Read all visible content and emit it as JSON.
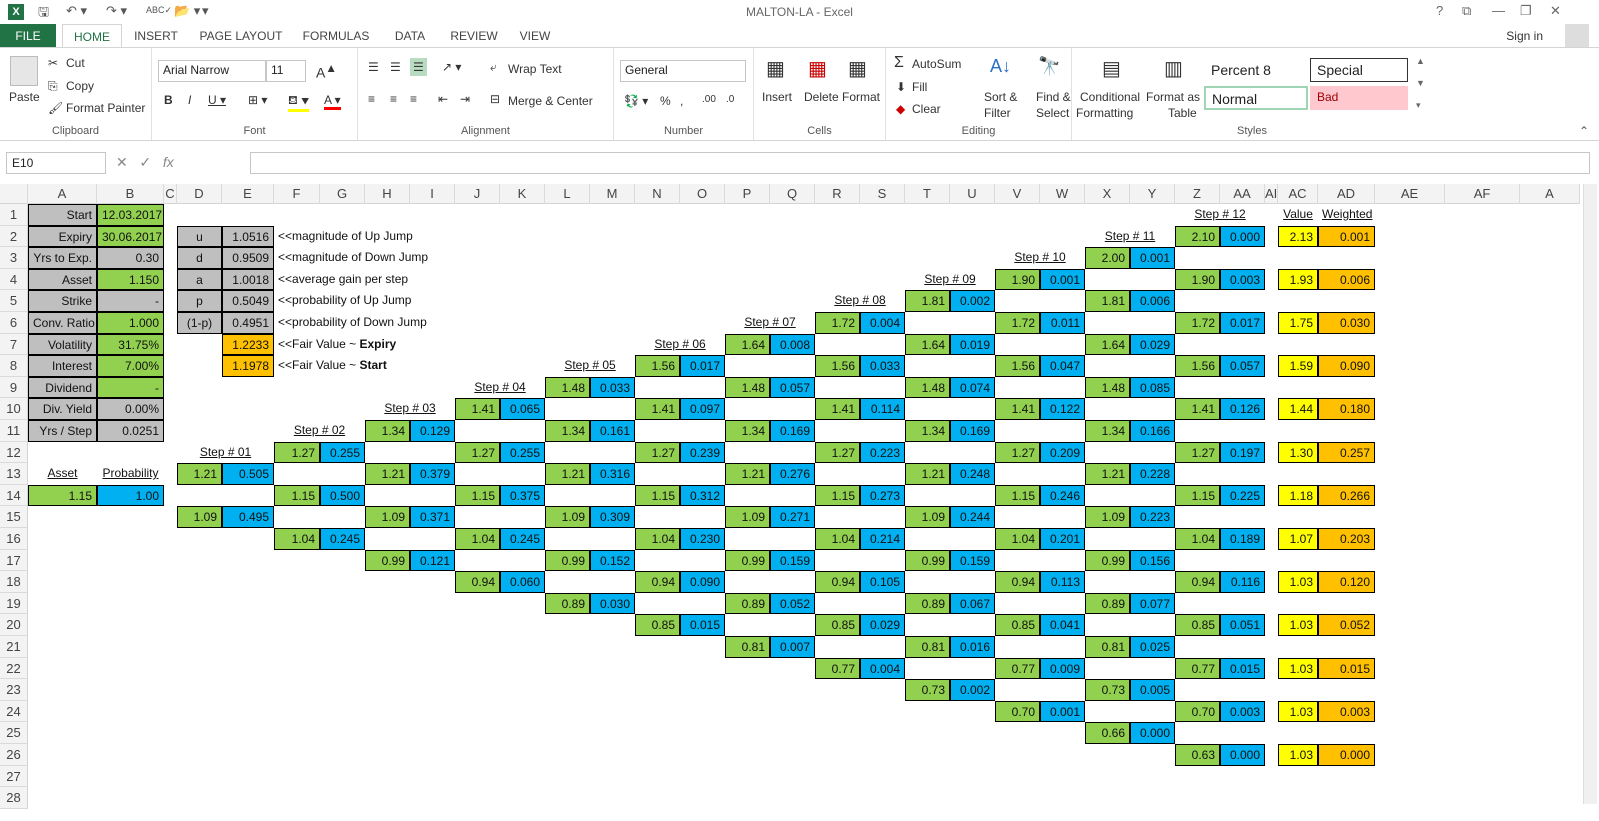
{
  "window": {
    "title": "MALTON-LA - Excel",
    "help": "?",
    "restore": "❐",
    "minimize": "—",
    "close": "✕"
  },
  "qat": {
    "save": "💾",
    "undo": "↶",
    "redo": "↷"
  },
  "ribbon_tabs": [
    "FILE",
    "HOME",
    "INSERT",
    "PAGE LAYOUT",
    "FORMULAS",
    "DATA",
    "REVIEW",
    "VIEW"
  ],
  "signin": "Sign in",
  "clipboard": {
    "paste": "Paste",
    "cut": "Cut",
    "copy": "Copy",
    "format_painter": "Format Painter",
    "label": "Clipboard"
  },
  "font": {
    "name": "Arial Narrow",
    "size": "11",
    "label": "Font"
  },
  "alignment": {
    "wrap": "Wrap Text",
    "merge": "Merge & Center",
    "label": "Alignment"
  },
  "number": {
    "format": "General",
    "label": "Number"
  },
  "cells": {
    "insert": "Insert",
    "delete": "Delete",
    "format": "Format",
    "label": "Cells"
  },
  "editing": {
    "autosum": "AutoSum",
    "fill": "Fill",
    "clear": "Clear",
    "sort": "Sort &",
    "sort2": "Filter",
    "find": "Find &",
    "find2": "Select",
    "label": "Editing"
  },
  "styles": {
    "cond": "Conditional",
    "cond2": "Formatting",
    "fmt_table": "Format as",
    "fmt_table2": "Table",
    "percent8": "Percent 8",
    "special": "Special",
    "normal": "Normal",
    "bad": "Bad",
    "label": "Styles"
  },
  "formula_bar": {
    "name_box": "E10",
    "formula": ""
  },
  "columns": [
    "A",
    "B",
    "C",
    "D",
    "E",
    "F",
    "G",
    "H",
    "I",
    "J",
    "K",
    "L",
    "M",
    "N",
    "O",
    "P",
    "Q",
    "R",
    "S",
    "T",
    "U",
    "V",
    "W",
    "X",
    "Y",
    "Z",
    "AA",
    "AI",
    "AC",
    "AD",
    "AE",
    "AF",
    "A"
  ],
  "rows": [
    "1",
    "2",
    "3",
    "4",
    "5",
    "6",
    "7",
    "8",
    "9",
    "10",
    "11",
    "12",
    "13",
    "14",
    "15",
    "16",
    "17",
    "18",
    "19",
    "20",
    "21",
    "22",
    "23",
    "24",
    "25",
    "26",
    "27",
    "28"
  ],
  "params": [
    {
      "label": "Start",
      "value": "12.03.2017"
    },
    {
      "label": "Expiry",
      "value": "30.06.2017"
    },
    {
      "label": "Yrs to Exp.",
      "value": "0.30"
    },
    {
      "label": "Asset",
      "value": "1.150"
    },
    {
      "label": "Strike",
      "value": "-"
    },
    {
      "label": "Conv. Ratio",
      "value": "1.000"
    },
    {
      "label": "Volatility",
      "value": "31.75%"
    },
    {
      "label": "Interest",
      "value": "7.00%"
    },
    {
      "label": "Dividend",
      "value": "-"
    },
    {
      "label": "Div. Yield",
      "value": "0.00%"
    },
    {
      "label": "Yrs / Step",
      "value": "0.0251"
    }
  ],
  "jumps": [
    {
      "k": "u",
      "v": "1.0516",
      "note": "<<magnitude of Up Jump"
    },
    {
      "k": "d",
      "v": "0.9509",
      "note": "<<magnitude of Down Jump"
    },
    {
      "k": "a",
      "v": "1.0018",
      "note": "<<average gain per step"
    },
    {
      "k": "p",
      "v": "0.5049",
      "note": "<<probability of Up Jump"
    },
    {
      "k": "(1-p)",
      "v": "0.4951",
      "note": "<<probability of Down Jump"
    }
  ],
  "fair": [
    {
      "v": "1.2233",
      "pre": "<<Fair Value ~ ",
      "bold": "Expiry"
    },
    {
      "v": "1.1978",
      "pre": "<<Fair Value ~ ",
      "bold": "Start"
    }
  ],
  "start_block": {
    "h_asset": "Asset",
    "h_prob": "Probability",
    "asset": "1.15",
    "prob": "1.00"
  },
  "steps": [
    {
      "label": "Step # 01",
      "nodes": [
        [
          "1.21",
          "0.505"
        ],
        [
          "1.09",
          "0.495"
        ]
      ]
    },
    {
      "label": "Step # 02",
      "nodes": [
        [
          "1.27",
          "0.255"
        ],
        [
          "1.15",
          "0.500"
        ],
        [
          "1.04",
          "0.245"
        ]
      ]
    },
    {
      "label": "Step # 03",
      "nodes": [
        [
          "1.34",
          "0.129"
        ],
        [
          "1.21",
          "0.379"
        ],
        [
          "1.09",
          "0.371"
        ],
        [
          "0.99",
          "0.121"
        ]
      ]
    },
    {
      "label": "Step # 04",
      "nodes": [
        [
          "1.41",
          "0.065"
        ],
        [
          "1.27",
          "0.255"
        ],
        [
          "1.15",
          "0.375"
        ],
        [
          "1.04",
          "0.245"
        ],
        [
          "0.94",
          "0.060"
        ]
      ]
    },
    {
      "label": "Step # 05",
      "nodes": [
        [
          "1.48",
          "0.033"
        ],
        [
          "1.34",
          "0.161"
        ],
        [
          "1.21",
          "0.316"
        ],
        [
          "1.09",
          "0.309"
        ],
        [
          "0.99",
          "0.152"
        ],
        [
          "0.89",
          "0.030"
        ]
      ]
    },
    {
      "label": "Step # 06",
      "nodes": [
        [
          "1.56",
          "0.017"
        ],
        [
          "1.41",
          "0.097"
        ],
        [
          "1.27",
          "0.239"
        ],
        [
          "1.15",
          "0.312"
        ],
        [
          "1.04",
          "0.230"
        ],
        [
          "0.94",
          "0.090"
        ],
        [
          "0.85",
          "0.015"
        ]
      ]
    },
    {
      "label": "Step # 07",
      "nodes": [
        [
          "1.64",
          "0.008"
        ],
        [
          "1.48",
          "0.057"
        ],
        [
          "1.34",
          "0.169"
        ],
        [
          "1.21",
          "0.276"
        ],
        [
          "1.09",
          "0.271"
        ],
        [
          "0.99",
          "0.159"
        ],
        [
          "0.89",
          "0.052"
        ],
        [
          "0.81",
          "0.007"
        ]
      ]
    },
    {
      "label": "Step # 08",
      "nodes": [
        [
          "1.72",
          "0.004"
        ],
        [
          "1.56",
          "0.033"
        ],
        [
          "1.41",
          "0.114"
        ],
        [
          "1.27",
          "0.223"
        ],
        [
          "1.15",
          "0.273"
        ],
        [
          "1.04",
          "0.214"
        ],
        [
          "0.94",
          "0.105"
        ],
        [
          "0.85",
          "0.029"
        ],
        [
          "0.77",
          "0.004"
        ]
      ]
    },
    {
      "label": "Step # 09",
      "nodes": [
        [
          "1.81",
          "0.002"
        ],
        [
          "1.64",
          "0.019"
        ],
        [
          "1.48",
          "0.074"
        ],
        [
          "1.34",
          "0.169"
        ],
        [
          "1.21",
          "0.248"
        ],
        [
          "1.09",
          "0.244"
        ],
        [
          "0.99",
          "0.159"
        ],
        [
          "0.89",
          "0.067"
        ],
        [
          "0.81",
          "0.016"
        ],
        [
          "0.73",
          "0.002"
        ]
      ]
    },
    {
      "label": "Step # 10",
      "nodes": [
        [
          "1.90",
          "0.001"
        ],
        [
          "1.72",
          "0.011"
        ],
        [
          "1.56",
          "0.047"
        ],
        [
          "1.41",
          "0.122"
        ],
        [
          "1.27",
          "0.209"
        ],
        [
          "1.15",
          "0.246"
        ],
        [
          "1.04",
          "0.201"
        ],
        [
          "0.94",
          "0.113"
        ],
        [
          "0.85",
          "0.041"
        ],
        [
          "0.77",
          "0.009"
        ],
        [
          "0.70",
          "0.001"
        ]
      ]
    },
    {
      "label": "Step # 11",
      "nodes": [
        [
          "2.00",
          "0.001"
        ],
        [
          "1.81",
          "0.006"
        ],
        [
          "1.64",
          "0.029"
        ],
        [
          "1.48",
          "0.085"
        ],
        [
          "1.34",
          "0.166"
        ],
        [
          "1.21",
          "0.228"
        ],
        [
          "1.09",
          "0.223"
        ],
        [
          "0.99",
          "0.156"
        ],
        [
          "0.89",
          "0.077"
        ],
        [
          "0.81",
          "0.025"
        ],
        [
          "0.73",
          "0.005"
        ],
        [
          "0.66",
          "0.000"
        ]
      ]
    },
    {
      "label": "Step # 12",
      "nodes": [
        [
          "2.10",
          "0.000"
        ],
        [
          "1.90",
          "0.003"
        ],
        [
          "1.72",
          "0.017"
        ],
        [
          "1.56",
          "0.057"
        ],
        [
          "1.41",
          "0.126"
        ],
        [
          "1.27",
          "0.197"
        ],
        [
          "1.15",
          "0.225"
        ],
        [
          "1.04",
          "0.189"
        ],
        [
          "0.94",
          "0.116"
        ],
        [
          "0.85",
          "0.051"
        ],
        [
          "0.77",
          "0.015"
        ],
        [
          "0.70",
          "0.003"
        ],
        [
          "0.63",
          "0.000"
        ]
      ]
    }
  ],
  "value_header": "Value",
  "weighted_header": "Weighted",
  "values": [
    [
      "2.13",
      "0.001"
    ],
    [
      "1.93",
      "0.006"
    ],
    [
      "1.75",
      "0.030"
    ],
    [
      "1.59",
      "0.090"
    ],
    [
      "1.44",
      "0.180"
    ],
    [
      "1.30",
      "0.257"
    ],
    [
      "1.18",
      "0.266"
    ],
    [
      "1.07",
      "0.203"
    ],
    [
      "1.03",
      "0.120"
    ],
    [
      "1.03",
      "0.052"
    ],
    [
      "1.03",
      "0.015"
    ],
    [
      "1.03",
      "0.003"
    ],
    [
      "1.03",
      "0.000"
    ]
  ]
}
